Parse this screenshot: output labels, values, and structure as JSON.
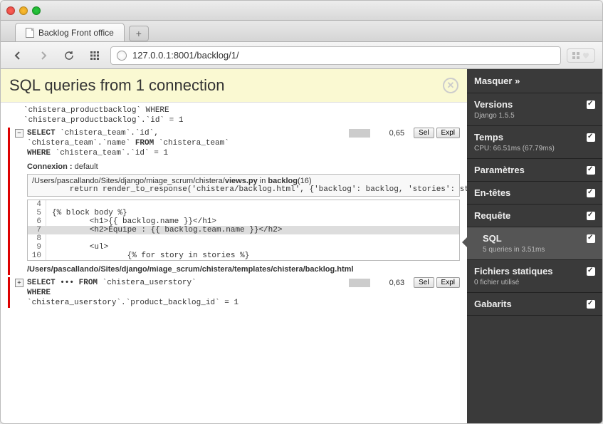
{
  "browser": {
    "tab_title": "Backlog Front office",
    "url": "127.0.0.1:8001/backlog/1/"
  },
  "header": {
    "title": "SQL queries from 1 connection"
  },
  "queries": {
    "q0": {
      "line1": "`chistera_productbacklog` WHERE",
      "line2": "`chistera_productbacklog`.`id` = 1"
    },
    "q1": {
      "select": "SELECT",
      "c1": " `chistera_team`.`id`,",
      "c2": "`chistera_team`.`name` ",
      "from": "FROM",
      "c3": " `chistera_team`",
      "where": "WHERE",
      "c4": " `chistera_team`.`id` = 1",
      "time": "0,65",
      "btn_sel": "Sel",
      "btn_expl": "Expl"
    },
    "connexion_label": "Connexion :",
    "connexion_value": " default",
    "trace": {
      "path": "/Users/pascallando/Sites/django/miage_scrum/chistera/",
      "file": "views.py",
      "in": " in ",
      "func": "backlog",
      "ln": "(16)",
      "body": "        return render_to_response('chistera/backlog.html', {'backlog': backlog, 'stories': stories})"
    },
    "code": {
      "l4": {
        "n": "4",
        "t": ""
      },
      "l5": {
        "n": "5",
        "t": "{% block body %}"
      },
      "l6": {
        "n": "6",
        "t": "        <h1>{{ backlog.name }}</h1>"
      },
      "l7": {
        "n": "7",
        "t": "        <h2>Équipe : {{ backlog.team.name }}</h2>"
      },
      "l8": {
        "n": "8",
        "t": ""
      },
      "l9": {
        "n": "9",
        "t": "        <ul>"
      },
      "l10": {
        "n": "10",
        "t": "                {% for story in stories %}"
      }
    },
    "template_path": "/Users/pascallando/Sites/django/miage_scrum/chistera/templates/chistera/backlog.html",
    "q2": {
      "select": "SELECT ••• FROM",
      "c1": " `chistera_userstory`",
      "where": "WHERE",
      "c2": "`chistera_userstory`.`product_backlog_id` = 1",
      "time": "0,63",
      "btn_sel": "Sel",
      "btn_expl": "Expl"
    }
  },
  "sidebar": {
    "hide": "Masquer »",
    "versions": {
      "title": "Versions",
      "sub": "Django 1.5.5"
    },
    "temps": {
      "title": "Temps",
      "sub": "CPU: 66.51ms (67.79ms)"
    },
    "parametres": {
      "title": "Paramètres"
    },
    "entetes": {
      "title": "En-têtes"
    },
    "requete": {
      "title": "Requête"
    },
    "sql": {
      "title": "SQL",
      "sub": "5 queries in 3.51ms"
    },
    "fichiers": {
      "title": "Fichiers statiques",
      "sub": "0 fichier utilisé"
    },
    "gabarits": {
      "title": "Gabarits"
    }
  }
}
